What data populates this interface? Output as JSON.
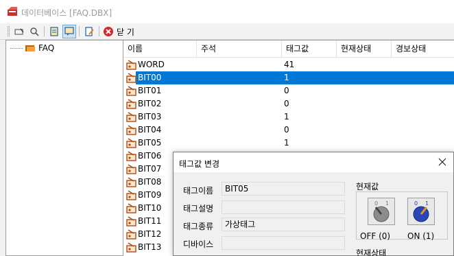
{
  "window": {
    "title": "데이터베이스 [FAQ.DBX]"
  },
  "toolbar": {
    "close_label": "닫 기"
  },
  "tree": {
    "root_label": "FAQ"
  },
  "list": {
    "columns": [
      "이름",
      "주석",
      "태그값",
      "현재상태",
      "경보상태"
    ],
    "rows": [
      {
        "name": "WORD",
        "value": "41"
      },
      {
        "name": "BIT00",
        "value": "1",
        "selected": true
      },
      {
        "name": "BIT01",
        "value": "0"
      },
      {
        "name": "BIT02",
        "value": "0"
      },
      {
        "name": "BIT03",
        "value": "1"
      },
      {
        "name": "BIT04",
        "value": "0"
      },
      {
        "name": "BIT05",
        "value": "1"
      },
      {
        "name": "BIT06",
        "value": ""
      },
      {
        "name": "BIT07",
        "value": ""
      },
      {
        "name": "BIT08",
        "value": ""
      },
      {
        "name": "BIT09",
        "value": ""
      },
      {
        "name": "BIT10",
        "value": ""
      },
      {
        "name": "BIT11",
        "value": ""
      },
      {
        "name": "BIT12",
        "value": ""
      },
      {
        "name": "BIT13",
        "value": ""
      }
    ]
  },
  "dialog": {
    "title": "태그값 변경",
    "fields": {
      "tag_name_label": "태그이름",
      "tag_name_value": "BIT05",
      "tag_desc_label": "태그설명",
      "tag_desc_value": "",
      "tag_type_label": "태그종류",
      "tag_type_value": "가상태그",
      "device_label": "디바이스",
      "device_value": ""
    },
    "current_value_group": "현재값",
    "off_label": "OFF (0)",
    "on_label": "ON (1)",
    "current_state_group": "현재상태"
  },
  "colors": {
    "selection": "#0078d7",
    "close_icon_red": "#d9262c"
  }
}
